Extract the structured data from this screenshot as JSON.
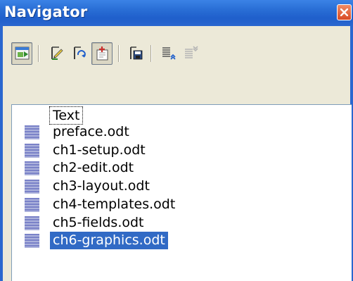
{
  "window": {
    "title": "Navigator",
    "title_color": "#ffffff",
    "titlebar_color": "#2a6fd6",
    "close_color": "#d84a24"
  },
  "toolbar": {
    "buttons": [
      {
        "name": "toggle-icon",
        "pressed": true
      },
      {
        "name": "edit-icon",
        "pressed": false
      },
      {
        "name": "update-icon",
        "pressed": false
      },
      {
        "name": "insert-icon",
        "pressed": true
      },
      {
        "name": "save-contents-icon",
        "pressed": false
      },
      {
        "name": "move-up-icon",
        "pressed": false
      },
      {
        "name": "move-down-icon",
        "pressed": false,
        "disabled": true
      }
    ]
  },
  "content": {
    "root": "Text",
    "items": [
      {
        "label": "preface.odt",
        "selected": false
      },
      {
        "label": "ch1-setup.odt",
        "selected": false
      },
      {
        "label": "ch2-edit.odt",
        "selected": false
      },
      {
        "label": "ch3-layout.odt",
        "selected": false
      },
      {
        "label": "ch4-templates.odt",
        "selected": false
      },
      {
        "label": "ch5-fields.odt",
        "selected": false
      },
      {
        "label": "ch6-graphics.odt",
        "selected": true
      }
    ],
    "selection_color": "#316ac5"
  }
}
